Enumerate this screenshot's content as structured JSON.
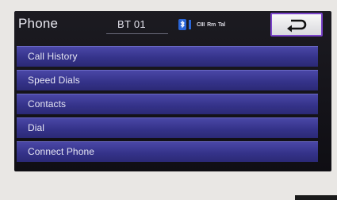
{
  "header": {
    "title": "Phone",
    "device_name": "BT 01",
    "status": {
      "bluetooth_icon": "bluetooth-icon",
      "battery_color": "#2a66d8",
      "indicators": [
        "CIII",
        "Rm",
        "Tal"
      ]
    },
    "back_icon": "back-arrow-icon"
  },
  "menu": {
    "items": [
      {
        "label": "Call History"
      },
      {
        "label": "Speed Dials"
      },
      {
        "label": "Contacts"
      },
      {
        "label": "Dial"
      },
      {
        "label": "Connect Phone"
      }
    ]
  },
  "colors": {
    "accent_border": "#7a43c9",
    "menu_bg": "#35338a"
  }
}
